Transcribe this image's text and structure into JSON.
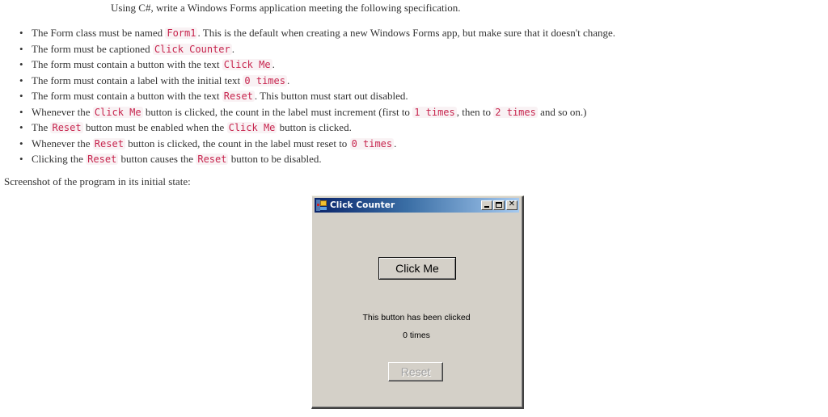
{
  "intro": "Using C#, write a Windows Forms application meeting the following specification.",
  "spec": [
    {
      "parts": [
        {
          "t": "text",
          "v": "The Form class must be named "
        },
        {
          "t": "code",
          "v": "Form1"
        },
        {
          "t": "text",
          "v": ". This is the default when creating a new Windows Forms app, but make sure that it doesn't change."
        }
      ]
    },
    {
      "parts": [
        {
          "t": "text",
          "v": "The form must be captioned "
        },
        {
          "t": "code",
          "v": "Click Counter"
        },
        {
          "t": "text",
          "v": "."
        }
      ]
    },
    {
      "parts": [
        {
          "t": "text",
          "v": "The form must contain a button with the text "
        },
        {
          "t": "code",
          "v": "Click Me"
        },
        {
          "t": "text",
          "v": "."
        }
      ]
    },
    {
      "parts": [
        {
          "t": "text",
          "v": "The form must contain a label with the initial text "
        },
        {
          "t": "code",
          "v": "0 times"
        },
        {
          "t": "text",
          "v": "."
        }
      ]
    },
    {
      "parts": [
        {
          "t": "text",
          "v": "The form must contain a button with the text "
        },
        {
          "t": "code",
          "v": "Reset"
        },
        {
          "t": "text",
          "v": ". This button must start out disabled."
        }
      ]
    },
    {
      "parts": [
        {
          "t": "text",
          "v": "Whenever the "
        },
        {
          "t": "code",
          "v": "Click Me"
        },
        {
          "t": "text",
          "v": " button is clicked, the count in the label must increment (first to "
        },
        {
          "t": "code",
          "v": "1 times"
        },
        {
          "t": "text",
          "v": ", then to "
        },
        {
          "t": "code",
          "v": "2 times"
        },
        {
          "t": "text",
          "v": " and so on.)"
        }
      ]
    },
    {
      "parts": [
        {
          "t": "text",
          "v": "The "
        },
        {
          "t": "code",
          "v": "Reset"
        },
        {
          "t": "text",
          "v": " button must be enabled when the "
        },
        {
          "t": "code",
          "v": "Click Me"
        },
        {
          "t": "text",
          "v": " button is clicked."
        }
      ]
    },
    {
      "parts": [
        {
          "t": "text",
          "v": "Whenever the "
        },
        {
          "t": "code",
          "v": "Reset"
        },
        {
          "t": "text",
          "v": " button is clicked, the count in the label must reset to "
        },
        {
          "t": "code",
          "v": "0 times"
        },
        {
          "t": "text",
          "v": "."
        }
      ]
    },
    {
      "parts": [
        {
          "t": "text",
          "v": "Clicking the "
        },
        {
          "t": "code",
          "v": "Reset"
        },
        {
          "t": "text",
          "v": " button causes the "
        },
        {
          "t": "code",
          "v": "Reset"
        },
        {
          "t": "text",
          "v": " button to be disabled."
        }
      ]
    }
  ],
  "screenshot_caption": "Screenshot of the program in its initial state:",
  "window": {
    "title": "Click Counter",
    "icon": "app-form-icon",
    "controls": {
      "minimize": "minimize-icon",
      "maximize": "maximize-icon",
      "close_glyph": "✕"
    },
    "click_button_label": "Click Me",
    "label_line1": "This button has been clicked",
    "label_line2": "0 times",
    "reset_button_label": "Reset",
    "reset_enabled": false
  },
  "colors": {
    "code_text": "#c7254e",
    "code_bg": "#f9f2f4",
    "titlebar_start": "#0a246a",
    "titlebar_end": "#a6caf0",
    "form_bg": "#d4d0c8"
  }
}
